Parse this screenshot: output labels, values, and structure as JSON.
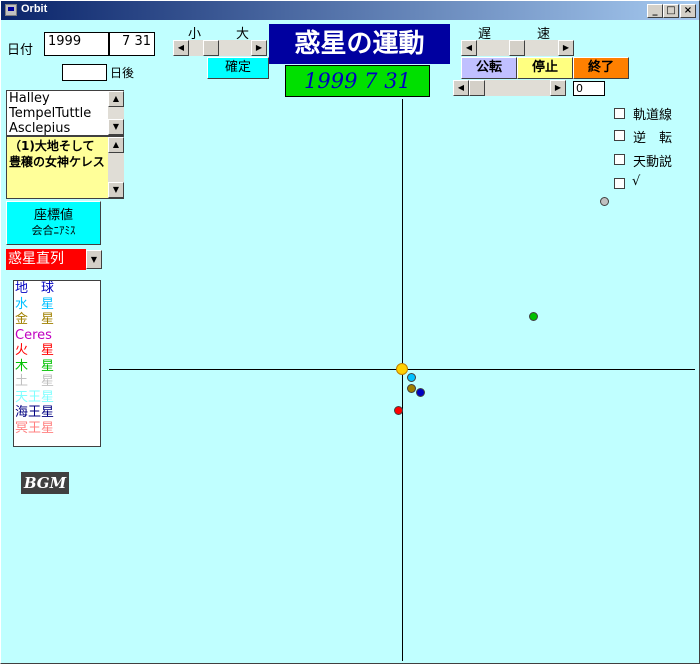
{
  "window": {
    "title": "Orbit"
  },
  "titlebar_buttons": {
    "minimize": "_",
    "maximize": "□",
    "close": "×"
  },
  "date": {
    "label": "日付",
    "year": "1999",
    "monthday": "7 31",
    "days_after_label": "日後",
    "days_after_value": ""
  },
  "zoom": {
    "small_label": "小",
    "large_label": "大",
    "confirm_label": "確定"
  },
  "main_title": "惑星の運動",
  "current_date": "1999 7 31",
  "speed": {
    "slow_label": "遅",
    "fast_label": "速",
    "value": "0"
  },
  "controls": {
    "revolve_label": "公転",
    "stop_label": "停止",
    "exit_label": "終了"
  },
  "options": [
    {
      "label": "軌道線",
      "checked": false
    },
    {
      "label": "逆　転",
      "checked": false
    },
    {
      "label": "天動説",
      "checked": false
    },
    {
      "label": "√",
      "checked": false
    }
  ],
  "comets": [
    "Halley",
    "TempelTuttle",
    "Asclepius"
  ],
  "info_text": "（1)大地そして豊穣の女神ケレス",
  "coord_button": {
    "line1": "座標値",
    "line2": "会合ﾆｱﾐｽ"
  },
  "mode_select": {
    "value": "惑星直列"
  },
  "planets": [
    {
      "name": "地　球",
      "color": "#0000c0"
    },
    {
      "name": "水　星",
      "color": "#00c0ff"
    },
    {
      "name": "金　星",
      "color": "#a08000"
    },
    {
      "name": "Ceres",
      "color": "#c000c0"
    },
    {
      "name": "火　星",
      "color": "#ff0000"
    },
    {
      "name": "木　星",
      "color": "#00c000"
    },
    {
      "name": "土　星",
      "color": "#c0c0c0"
    },
    {
      "name": "天王星",
      "color": "#80ffff"
    },
    {
      "name": "海王星",
      "color": "#000080"
    },
    {
      "name": "冥王星",
      "color": "#ff8080"
    }
  ],
  "bgm_label": "BGM",
  "colors": {
    "background": "#c0ffff",
    "title_bg": "#0000a0",
    "date_bg": "#00e000",
    "confirm_bg": "#00ffff",
    "revolve_bg": "#c0c0ff",
    "stop_bg": "#ffff80",
    "exit_bg": "#ff8000",
    "mode_bg": "#ff0000",
    "info_bg": "#ffff99"
  }
}
